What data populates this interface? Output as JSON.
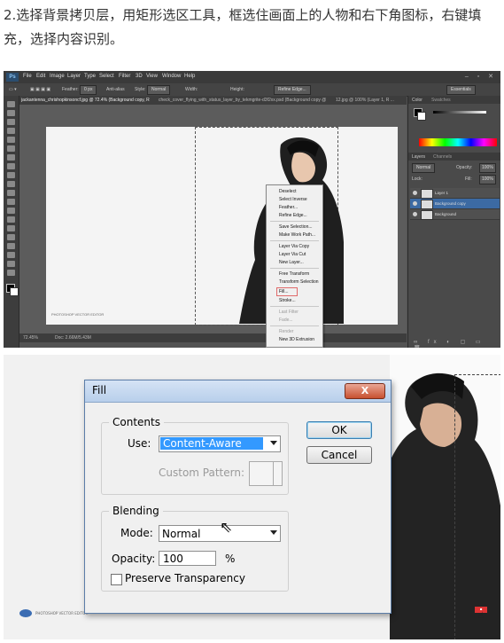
{
  "caption": "2.选择背景拷贝层，用矩形选区工具，框选住画面上的人物和右下角图标，右键填充，选择内容识别。",
  "photoshop": {
    "logo": "Ps",
    "menu": [
      "File",
      "Edit",
      "Image",
      "Layer",
      "Type",
      "Select",
      "Filter",
      "3D",
      "View",
      "Window",
      "Help"
    ],
    "options": {
      "feather_label": "Feather:",
      "feather_value": "0 px",
      "antialias": "Anti-alias",
      "style_label": "Style:",
      "style_value": "Normal",
      "width_label": "Width:",
      "height_label": "Height:",
      "refine_edge": "Refine Edge...",
      "workspace": "Essentials"
    },
    "tabs": [
      "jackantenna_chrishopkinsoncf.jpg @ 72.4% (Background copy, RGB/8)",
      "check_cover_flying_with_status_layer_by_tekmgrite-d3f2xx.psd (Background copy @ 100% ...",
      "12.jpg @ 100% (Layer 1, R ..."
    ],
    "status_zoom": "72.45%",
    "status_doc": "Doc: 2.66M/5.43M",
    "watermark": "PHOTOSHOP VECTOR EDITOR",
    "context_menu": {
      "items": [
        "Deselect",
        "Select Inverse",
        "Feather...",
        "Refine Edge...",
        "Save Selection...",
        "Make Work Path...",
        "Layer Via Copy",
        "Layer Via Cut",
        "New Layer...",
        "Free Transform",
        "Transform Selection",
        "Fill...",
        "Stroke...",
        "Last Filter",
        "Fade...",
        "Render",
        "New 3D Extrusion"
      ]
    },
    "panels": {
      "color_tab": "Color",
      "swatches_tab": "Swatches",
      "layers_tab": "Layers",
      "channels_tab": "Channels",
      "blend_mode": "Normal",
      "opacity_label": "Opacity:",
      "opacity_value": "100%",
      "lock_label": "Lock:",
      "fill_label": "Fill:",
      "fill_value": "100%",
      "layers": [
        "Layer 1",
        "Background copy",
        "Background"
      ]
    }
  },
  "fill_dialog": {
    "title": "Fill",
    "close": "X",
    "contents_legend": "Contents",
    "use_label": "Use:",
    "use_value": "Content-Aware",
    "custom_pattern_label": "Custom Pattern:",
    "blending_legend": "Blending",
    "mode_label": "Mode:",
    "mode_value": "Normal",
    "opacity_label": "Opacity:",
    "opacity_value": "100",
    "opacity_unit": "%",
    "preserve_label": "Preserve Transparency",
    "ok_label": "OK",
    "cancel_label": "Cancel",
    "watermark": "PHOTOSHOP VECTOR EDITOR"
  }
}
